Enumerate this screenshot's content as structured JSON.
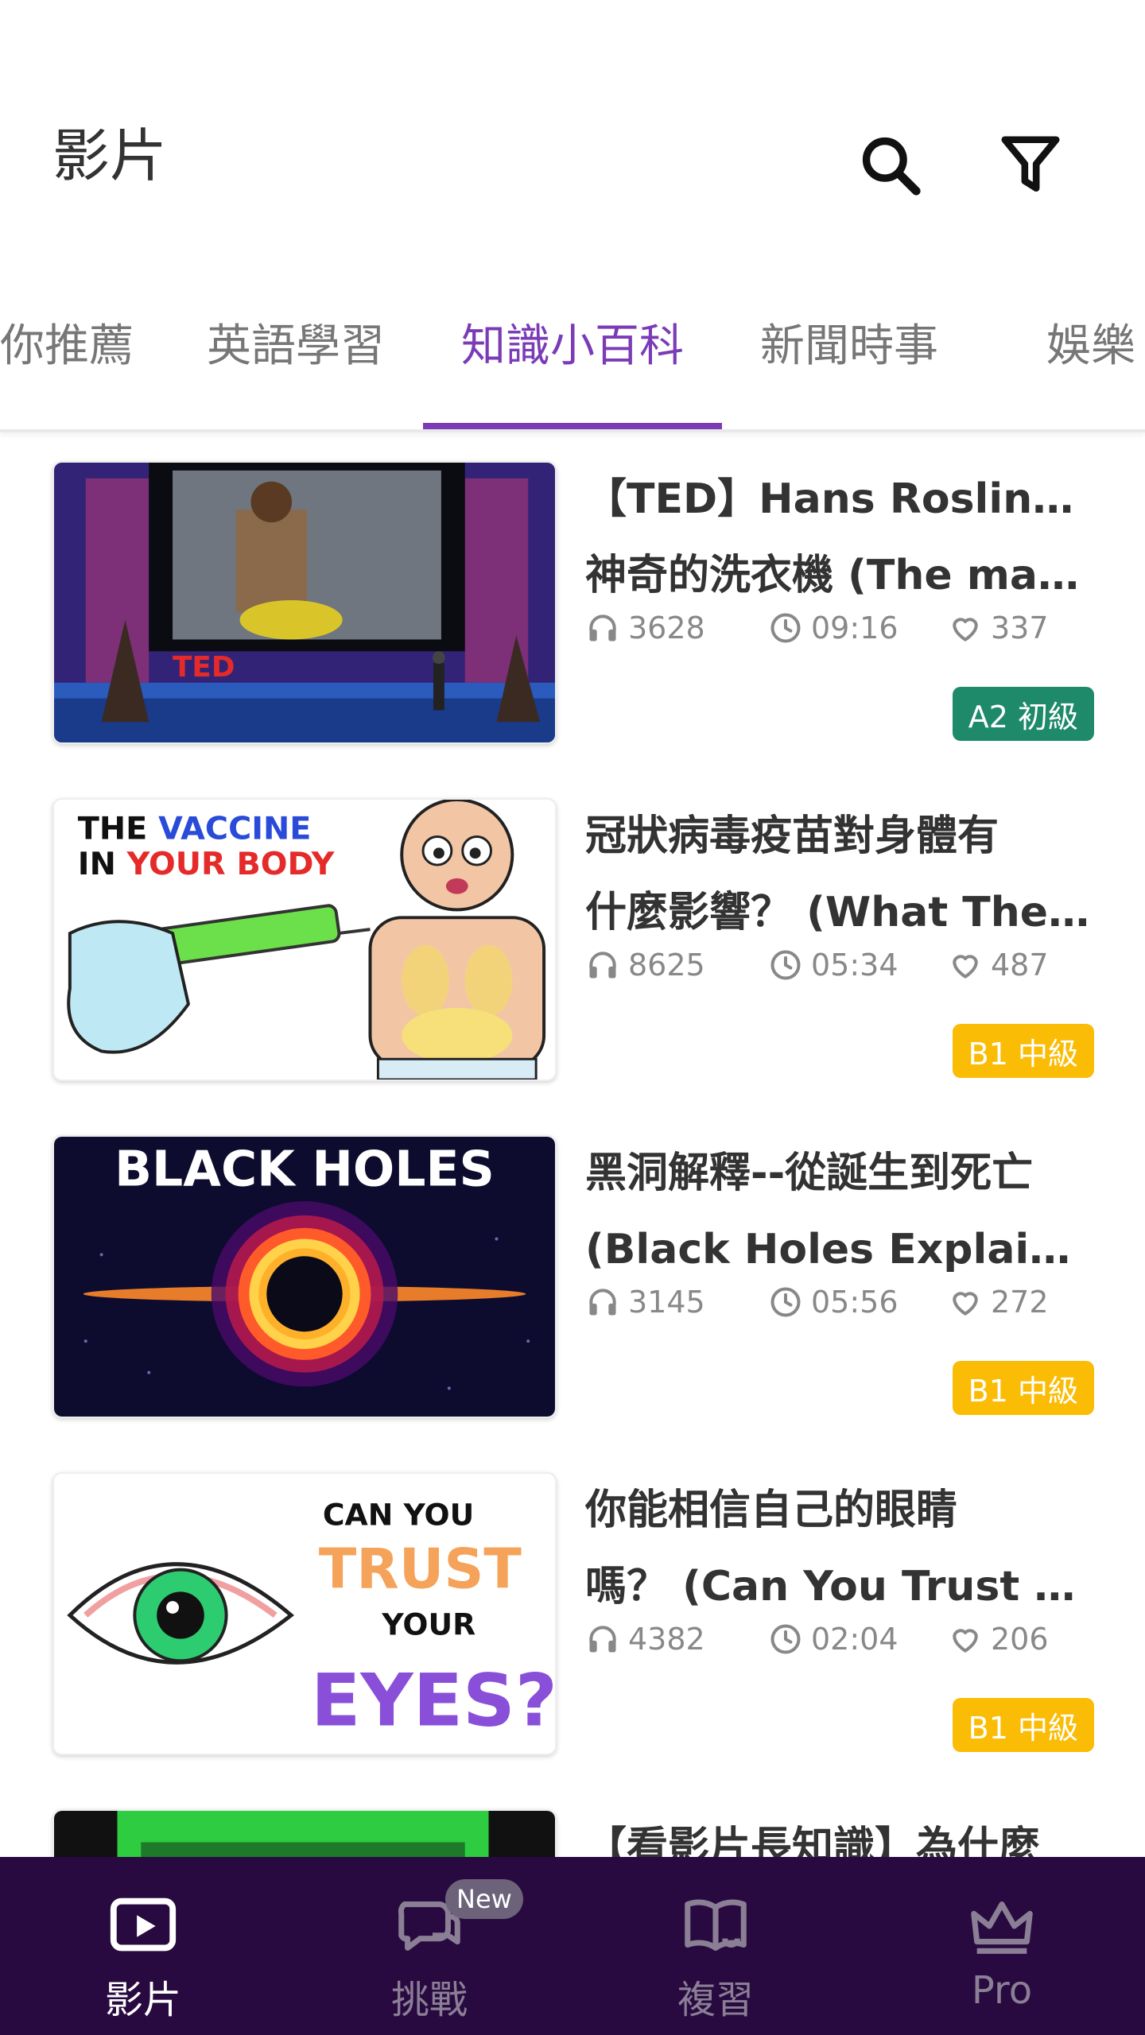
{
  "header": {
    "title": "影片",
    "search_icon": "search-icon",
    "filter_icon": "filter-icon"
  },
  "tabs": [
    {
      "label": "你推薦",
      "active": false
    },
    {
      "label": "英語學習",
      "active": false
    },
    {
      "label": "知識小百科",
      "active": true
    },
    {
      "label": "新聞時事",
      "active": false
    },
    {
      "label": "娛樂",
      "active": false
    }
  ],
  "colors": {
    "accent": "#7b3bb7",
    "nav_bg": "#280a40",
    "badge_a2": "#1e8a6a",
    "badge_b1": "#fbbc05"
  },
  "videos": [
    {
      "title_line1": "【TED】Hans Rosling 與",
      "title_line2": "神奇的洗衣機 (The mag…",
      "listens": "3628",
      "duration": "09:16",
      "likes": "337",
      "level": "A2 初級",
      "level_color": "#1e8a6a"
    },
    {
      "title_line1": "冠狀病毒疫苗對身體有",
      "title_line2": "什麼影響？ (What The …",
      "listens": "8625",
      "duration": "05:34",
      "likes": "487",
      "level": "B1 中級",
      "level_color": "#fbbc05"
    },
    {
      "title_line1": "黑洞解釋--從誕生到死亡",
      "title_line2": "(Black Holes Explained …",
      "listens": "3145",
      "duration": "05:56",
      "likes": "272",
      "level": "B1 中級",
      "level_color": "#fbbc05"
    },
    {
      "title_line1": "你能相信自己的眼睛",
      "title_line2": "嗎？ (Can You Trust Yo…",
      "listens": "4382",
      "duration": "02:04",
      "likes": "206",
      "level": "B1 中級",
      "level_color": "#fbbc05"
    },
    {
      "title_line1": "【看影片長知識】為什麼",
      "title_line2": "",
      "listens": "",
      "duration": "",
      "likes": "",
      "level": "",
      "level_color": ""
    }
  ],
  "thumbnails": {
    "ted_text": "TED",
    "vaccine_line1a": "THE ",
    "vaccine_line1b": "VACCINE",
    "vaccine_line2a": "IN ",
    "vaccine_line2b": "YOUR BODY",
    "blackholes_text": "BLACK HOLES",
    "eyes_line1": "CAN YOU",
    "eyes_line2": "TRUST",
    "eyes_line3": "YOUR",
    "eyes_line4": "EYES?"
  },
  "bottom_nav": [
    {
      "label": "影片",
      "icon": "video-play-icon",
      "active": true
    },
    {
      "label": "挑戰",
      "icon": "chat-bubbles-icon",
      "active": false
    },
    {
      "label": "複習",
      "icon": "book-review-icon",
      "active": false,
      "badge": "New"
    },
    {
      "label": "Pro",
      "icon": "crown-icon",
      "active": false
    }
  ]
}
